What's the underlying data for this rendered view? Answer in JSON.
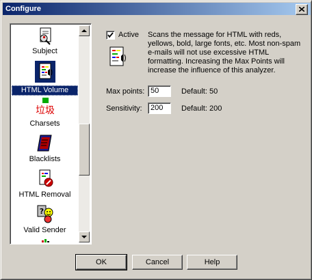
{
  "window": {
    "title": "Configure"
  },
  "analyzers": [
    {
      "label": "Subject",
      "icon": "subject-document-icon"
    },
    {
      "label": "HTML Volume",
      "icon": "html-volume-icon"
    },
    {
      "label": "Charsets",
      "icon": "charsets-icon"
    },
    {
      "label": "Blacklists",
      "icon": "blacklists-book-icon"
    },
    {
      "label": "HTML Removal",
      "icon": "html-removal-icon"
    },
    {
      "label": "Valid Sender",
      "icon": "valid-sender-icon"
    }
  ],
  "selected_analyzer": "HTML Volume",
  "settings": {
    "active_label": "Active",
    "active_checked": true,
    "description": "Scans the message for HTML with reds, yellows, bold, large fonts, etc.  Most non-spam e-mails will not use excessive HTML formatting.  Increasing the Max Points will increase the influence of this analyzer.",
    "max_points_label": "Max points:",
    "max_points_value": "50",
    "max_points_default": "Default: 50",
    "sensitivity_label": "Sensitivity:",
    "sensitivity_value": "200",
    "sensitivity_default": "Default: 200"
  },
  "buttons": {
    "ok": "OK",
    "cancel": "Cancel",
    "help": "Help"
  },
  "colors": {
    "title_start": "#0a246a",
    "title_end": "#a6caf0",
    "selection": "#0a246a",
    "face": "#d4d0c8"
  }
}
